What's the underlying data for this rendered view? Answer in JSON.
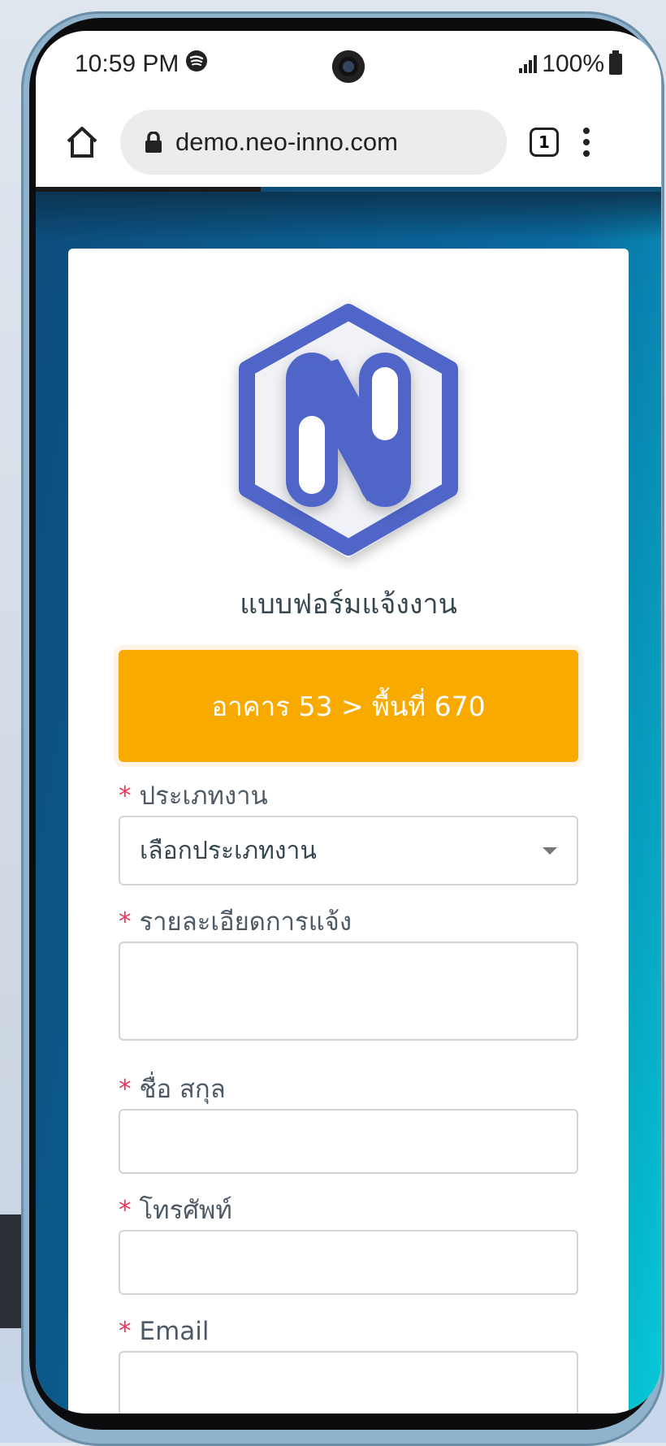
{
  "status_bar": {
    "time": "10:59 PM",
    "battery": "100%"
  },
  "browser": {
    "url": "demo.neo-inno.com",
    "tab_count": "1",
    "load_progress": 0.36
  },
  "form": {
    "title": "แบบฟอร์มแจ้งงาน",
    "location": "อาคาร 53 > พื้นที่ 670",
    "required_mark": "*",
    "fields": {
      "job_type": {
        "label": "ประเภทงาน",
        "value": "เลือกประเภทงาน"
      },
      "details": {
        "label": "รายละเอียดการแจ้ง",
        "value": ""
      },
      "name": {
        "label": "ชื่อ สกุล",
        "value": ""
      },
      "phone": {
        "label": "โทรศัพท์",
        "value": ""
      },
      "email": {
        "label": "Email",
        "value": ""
      }
    }
  },
  "colors": {
    "accent": "#f9aa00",
    "logo": "#4f66c8",
    "page_bg": "#0a5f92",
    "required": "#e8345b"
  },
  "icons": [
    "spotify-icon",
    "signal-icon",
    "battery-icon",
    "home-icon",
    "lock-icon",
    "tabs-icon",
    "more-vert-icon",
    "dropdown-caret-icon"
  ]
}
